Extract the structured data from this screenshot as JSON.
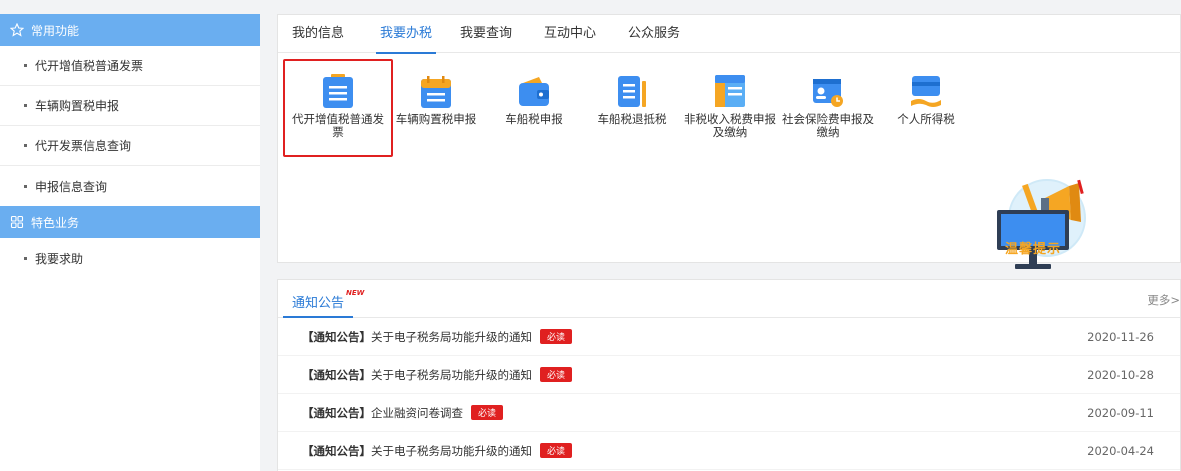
{
  "sidebar": {
    "sections": [
      {
        "title": "常用功能",
        "icon": "star-icon",
        "items": [
          "代开增值税普通发票",
          "车辆购置税申报",
          "代开发票信息查询",
          "申报信息查询"
        ]
      },
      {
        "title": "特色业务",
        "icon": "grid-icon",
        "items": [
          "我要求助"
        ]
      }
    ]
  },
  "tabs": [
    {
      "label": "我的信息",
      "active": false
    },
    {
      "label": "我要办税",
      "active": true
    },
    {
      "label": "我要查询",
      "active": false
    },
    {
      "label": "互动中心",
      "active": false
    },
    {
      "label": "公众服务",
      "active": false
    }
  ],
  "services": [
    {
      "label": "代开增值税普通发票",
      "icon": "invoice-doc-icon",
      "highlighted": true
    },
    {
      "label": "车辆购置税申报",
      "icon": "vehicle-tax-doc-icon"
    },
    {
      "label": "车船税申报",
      "icon": "wallet-icon"
    },
    {
      "label": "车船税退抵税",
      "icon": "tax-refund-doc-icon"
    },
    {
      "label": "非税收入税费申报及缴纳",
      "icon": "non-tax-layout-icon"
    },
    {
      "label": "社会保险费申报及缴纳",
      "icon": "social-insurance-card-icon"
    },
    {
      "label": "个人所得税",
      "icon": "personal-tax-card-icon"
    }
  ],
  "tip": {
    "label": "温馨提示"
  },
  "notice": {
    "title": "通知公告",
    "badge": "NEW",
    "more": "更多>",
    "items": [
      {
        "tag": "【通知公告】",
        "text": "关于电子税务局功能升级的通知",
        "must": "必读",
        "date": "2020-11-26"
      },
      {
        "tag": "【通知公告】",
        "text": "关于电子税务局功能升级的通知",
        "must": "必读",
        "date": "2020-10-28"
      },
      {
        "tag": "【通知公告】",
        "text": "企业融资问卷调查",
        "must": "必读",
        "date": "2020-09-11"
      },
      {
        "tag": "【通知公告】",
        "text": "关于电子税务局功能升级的通知",
        "must": "必读",
        "date": "2020-04-24"
      }
    ]
  },
  "colors": {
    "accent": "#2a7ad6",
    "sidebar_header": "#6aaef0",
    "alert": "#e02020"
  }
}
